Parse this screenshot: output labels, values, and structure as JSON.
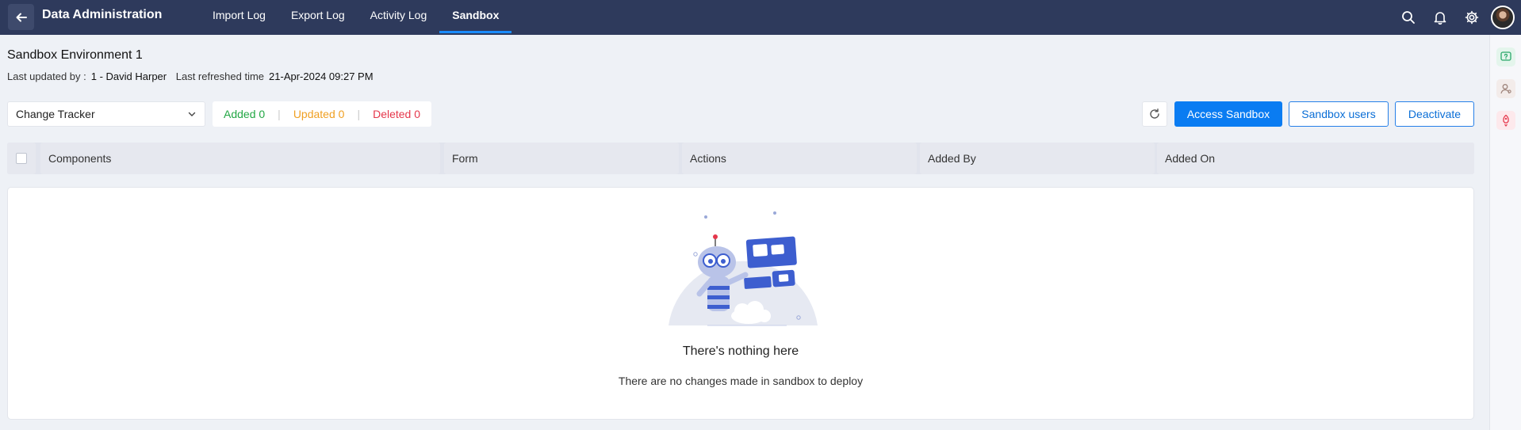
{
  "header": {
    "app_title": "Data Administration",
    "tabs": [
      {
        "label": "Import Log"
      },
      {
        "label": "Export Log"
      },
      {
        "label": "Activity Log"
      },
      {
        "label": "Sandbox",
        "active": true
      }
    ],
    "icons": [
      "back-arrow-icon",
      "search-icon",
      "bell-icon",
      "gear-icon",
      "avatar"
    ]
  },
  "environment": {
    "title": "Sandbox Environment 1",
    "last_updated_label": "Last updated by :",
    "last_updated_value": "1 - David Harper",
    "last_refreshed_label": "Last refreshed time",
    "last_refreshed_value": "21-Apr-2024 09:27 PM"
  },
  "toolbar": {
    "tracker_value": "Change Tracker",
    "added_label": "Added",
    "added_count": "0",
    "updated_label": "Updated",
    "updated_count": "0",
    "deleted_label": "Deleted",
    "deleted_count": "0",
    "access_label": "Access Sandbox",
    "users_label": "Sandbox users",
    "deactivate_label": "Deactivate"
  },
  "table": {
    "columns": [
      "Components",
      "Form",
      "Actions",
      "Added By",
      "Added On"
    ]
  },
  "empty_state": {
    "title": "There's nothing here",
    "subtitle": "There are no changes made in sandbox to deploy"
  },
  "colors": {
    "topbar": "#2e3a5c",
    "primary": "#0a7cf2",
    "added": "#22a744",
    "updated": "#f0a022",
    "deleted": "#e5374b"
  }
}
